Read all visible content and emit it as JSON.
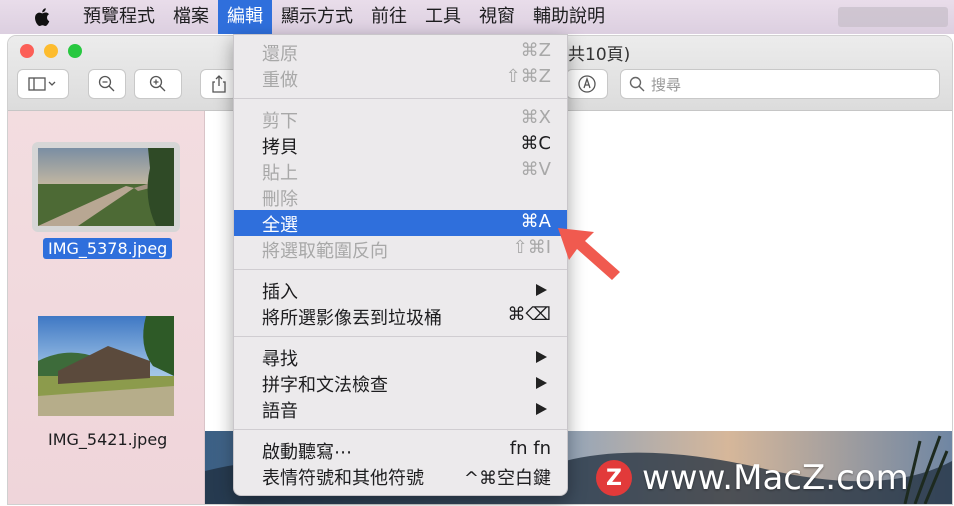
{
  "menubar": {
    "items": [
      "預覽程式",
      "檔案",
      "編輯",
      "顯示方式",
      "前往",
      "工具",
      "視窗",
      "輔助說明"
    ],
    "active_index": 2
  },
  "window": {
    "title": "共10頁)"
  },
  "toolbar": {
    "search_placeholder": "搜尋"
  },
  "sidebar": {
    "files": [
      {
        "name": "IMG_5378.jpeg",
        "selected": true
      },
      {
        "name": "IMG_5421.jpeg",
        "selected": false
      }
    ]
  },
  "edit_menu": {
    "items": [
      {
        "label": "還原",
        "shortcut": "⌘Z",
        "enabled": false
      },
      {
        "label": "重做",
        "shortcut": "⇧⌘Z",
        "enabled": false
      },
      {
        "label": "剪下",
        "shortcut": "⌘X",
        "enabled": false
      },
      {
        "label": "拷貝",
        "shortcut": "⌘C",
        "enabled": true
      },
      {
        "label": "貼上",
        "shortcut": "⌘V",
        "enabled": false
      },
      {
        "label": "刪除",
        "shortcut": "",
        "enabled": false
      },
      {
        "label": "全選",
        "shortcut": "⌘A",
        "enabled": true,
        "highlighted": true
      },
      {
        "label": "將選取範圍反向",
        "shortcut": "⇧⌘I",
        "enabled": false
      },
      {
        "label": "插入",
        "submenu": true,
        "enabled": true
      },
      {
        "label": "將所選影像丟到垃圾桶",
        "shortcut": "⌘⌫",
        "enabled": true
      },
      {
        "label": "尋找",
        "submenu": true,
        "enabled": true
      },
      {
        "label": "拼字和文法檢查",
        "submenu": true,
        "enabled": true
      },
      {
        "label": "語音",
        "submenu": true,
        "enabled": true
      },
      {
        "label": "啟動聽寫⋯",
        "shortcut": "fn fn",
        "enabled": true
      },
      {
        "label": "表情符號和其他符號",
        "shortcut": "^⌘空白鍵",
        "enabled": true
      }
    ]
  },
  "watermark": {
    "logo": "Z",
    "text": "www.MacZ.com"
  },
  "colors": {
    "accent": "#2f6fdc",
    "pointer_arrow": "#f05a4f"
  }
}
